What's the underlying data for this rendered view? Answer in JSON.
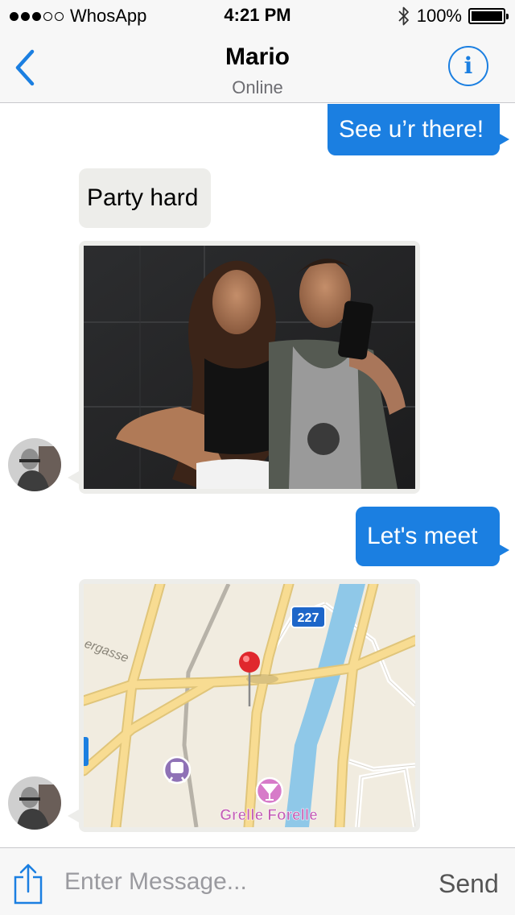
{
  "status_bar": {
    "signal_dots_filled": 3,
    "signal_dots_total": 5,
    "carrier": "WhosApp",
    "time": "4:21 PM",
    "bluetooth_icon": "bluetooth-icon",
    "battery": "100%",
    "battery_level": 1.0
  },
  "navbar": {
    "back_icon": "chevron-left-icon",
    "title": "Mario",
    "subtitle": "Online",
    "info_icon": "info-icon",
    "info_glyph": "i"
  },
  "messages": [
    {
      "direction": "outgoing",
      "type": "text",
      "text": "See u’r there!"
    },
    {
      "direction": "incoming",
      "type": "text",
      "text": "Party hard"
    },
    {
      "direction": "incoming",
      "type": "photo",
      "icon": "photo-thumbnail"
    },
    {
      "direction": "outgoing",
      "type": "text",
      "text": "Let's meet"
    },
    {
      "direction": "incoming",
      "type": "map",
      "map": {
        "road_label": "ergasse",
        "route_shield": "227",
        "poi_label": "Grelle Forelle"
      }
    }
  ],
  "input_bar": {
    "share_icon": "share-icon",
    "placeholder": "Enter Message...",
    "value": "",
    "send_label": "Send"
  },
  "colors": {
    "accent": "#1b7fe1",
    "incoming_bubble": "#ededea",
    "bar_background": "#f7f7f7",
    "map_river": "#8fc8e8",
    "map_land": "#f1ece0",
    "map_road": "#f7d88a",
    "pin": "#e0282d"
  }
}
